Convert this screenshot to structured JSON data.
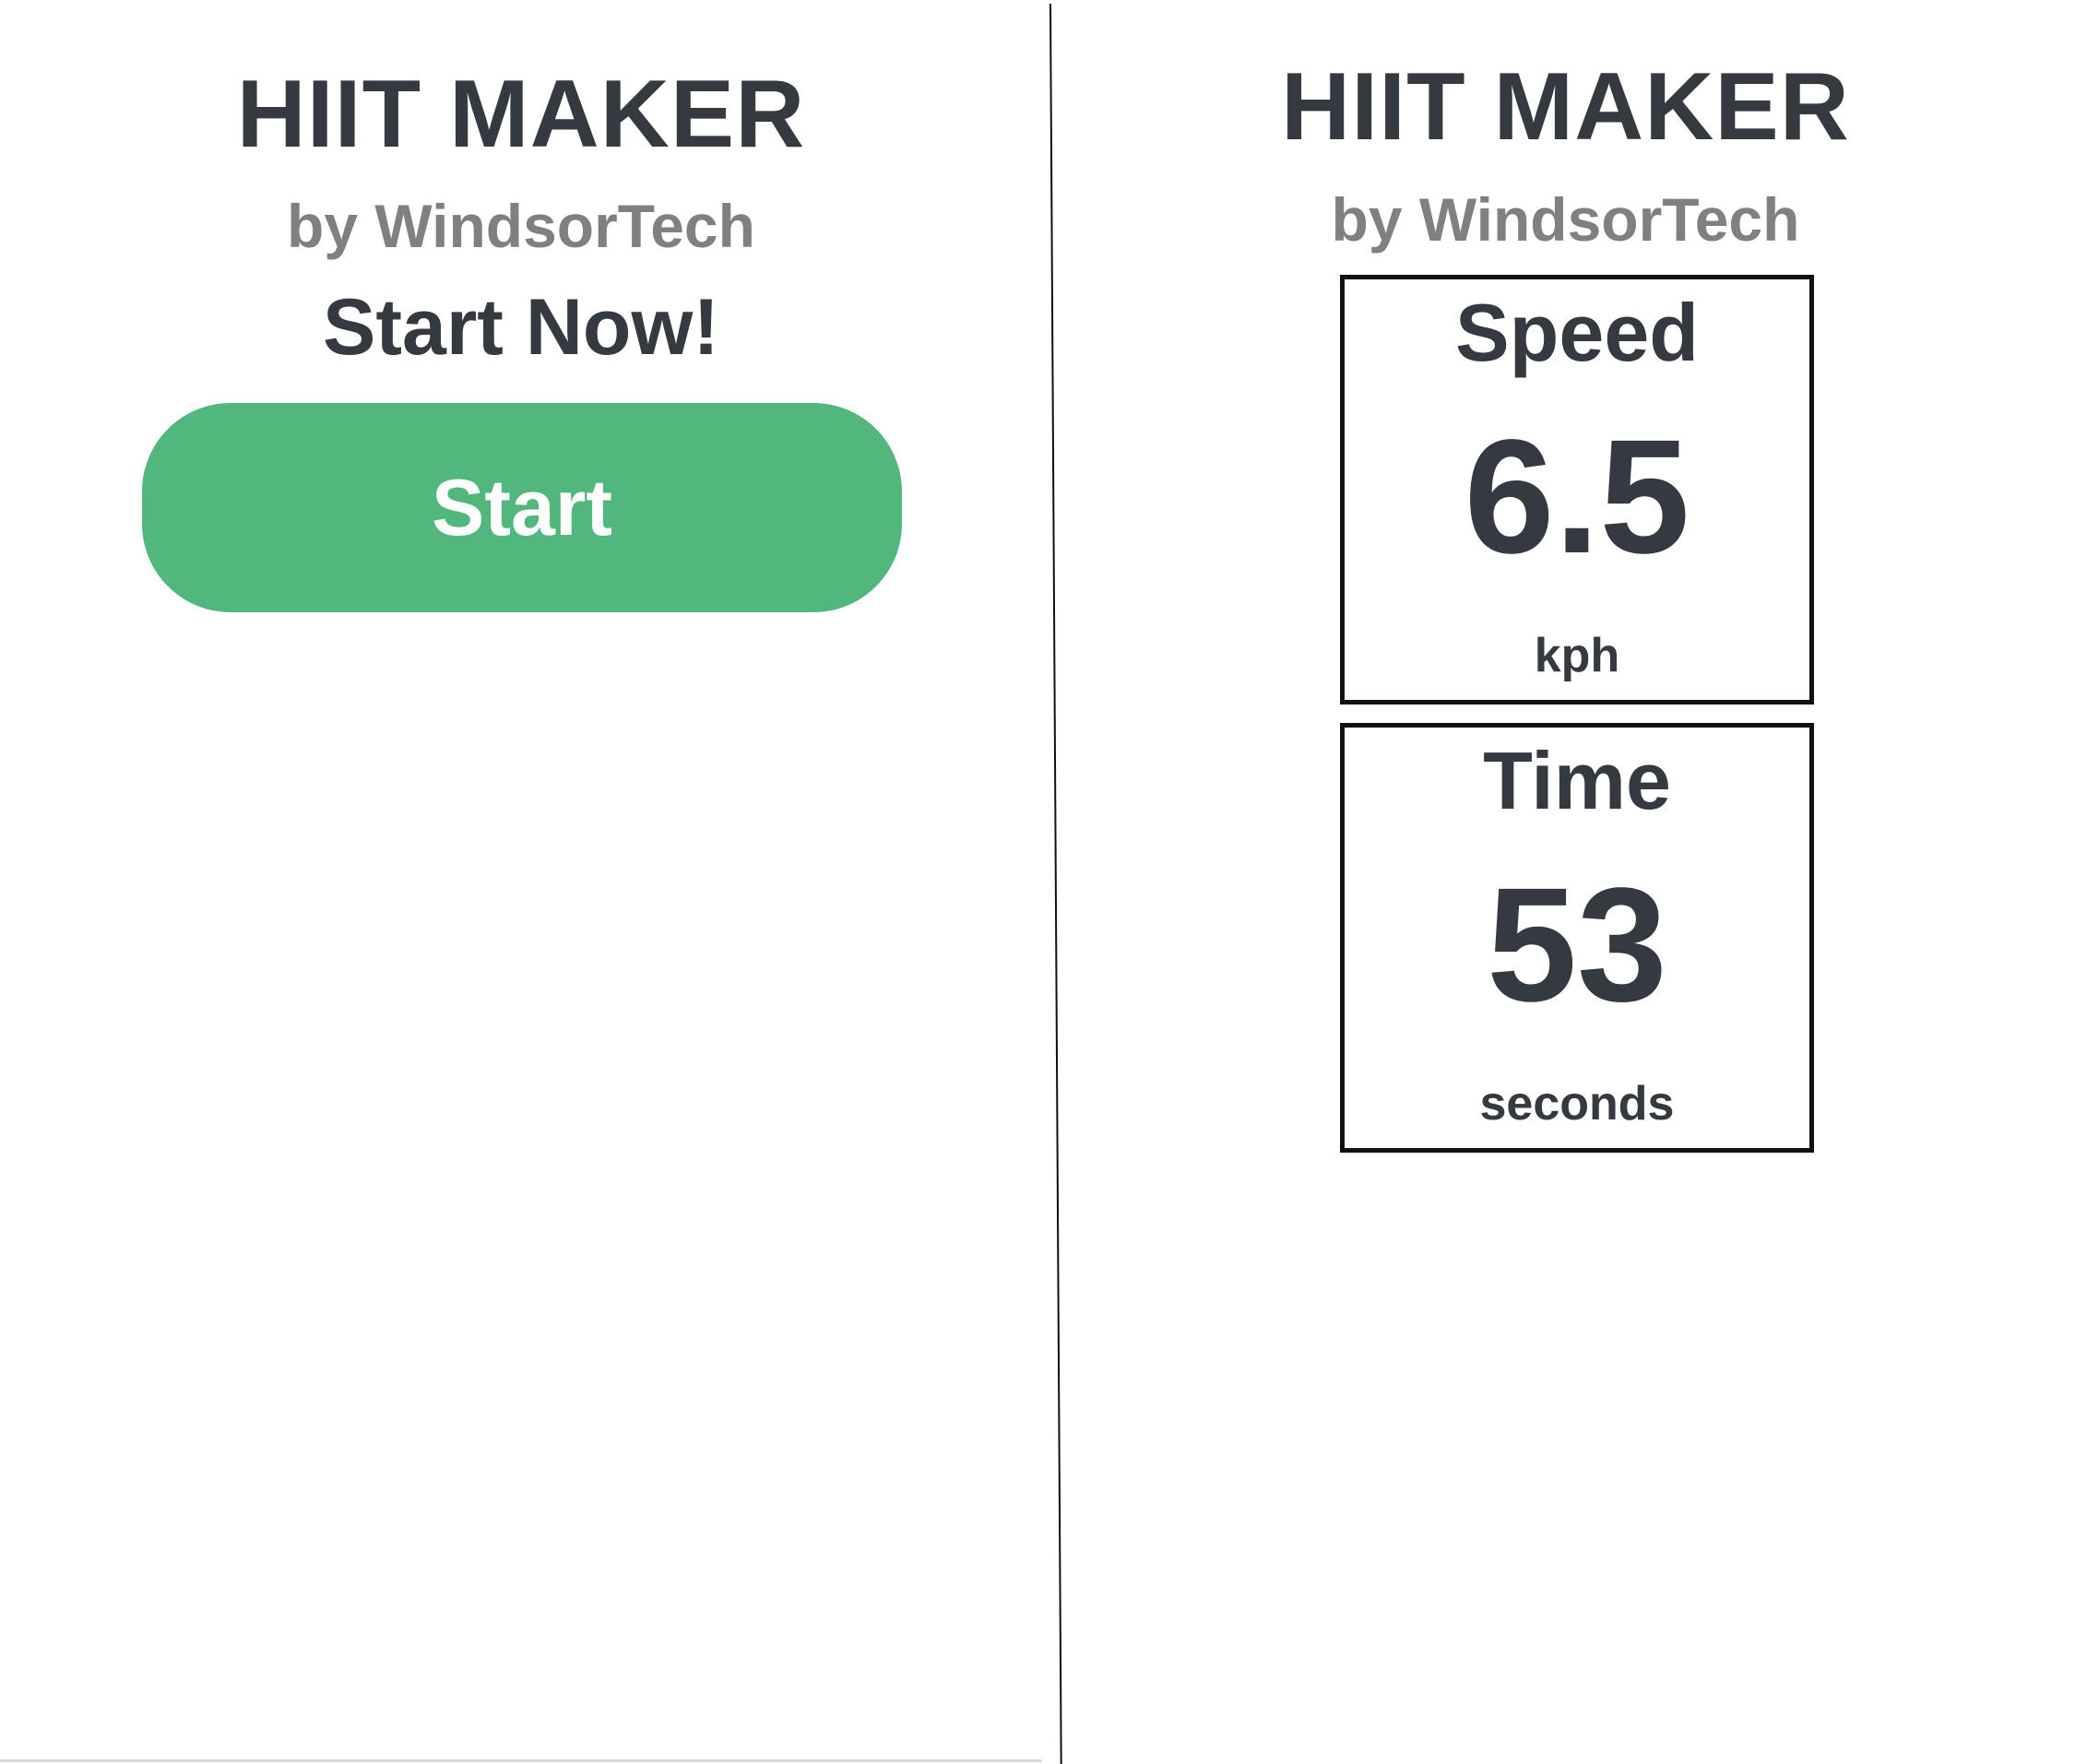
{
  "left_screen": {
    "title": "HIIT MAKER",
    "subtitle": "by WindsorTech",
    "prompt": "Start Now!",
    "start_button_label": "Start"
  },
  "right_screen": {
    "title": "HIIT MAKER",
    "subtitle": "by WindsorTech",
    "speed": {
      "label": "Speed",
      "value": "6.5",
      "unit": "kph"
    },
    "time": {
      "label": "Time",
      "value": "53",
      "unit": "seconds"
    }
  },
  "colors": {
    "text_dark": "#343a40",
    "text_muted": "#808080",
    "start_button_bg": "#52b77c",
    "start_button_text": "#ffffff",
    "box_border": "#111111",
    "background": "#ffffff"
  }
}
